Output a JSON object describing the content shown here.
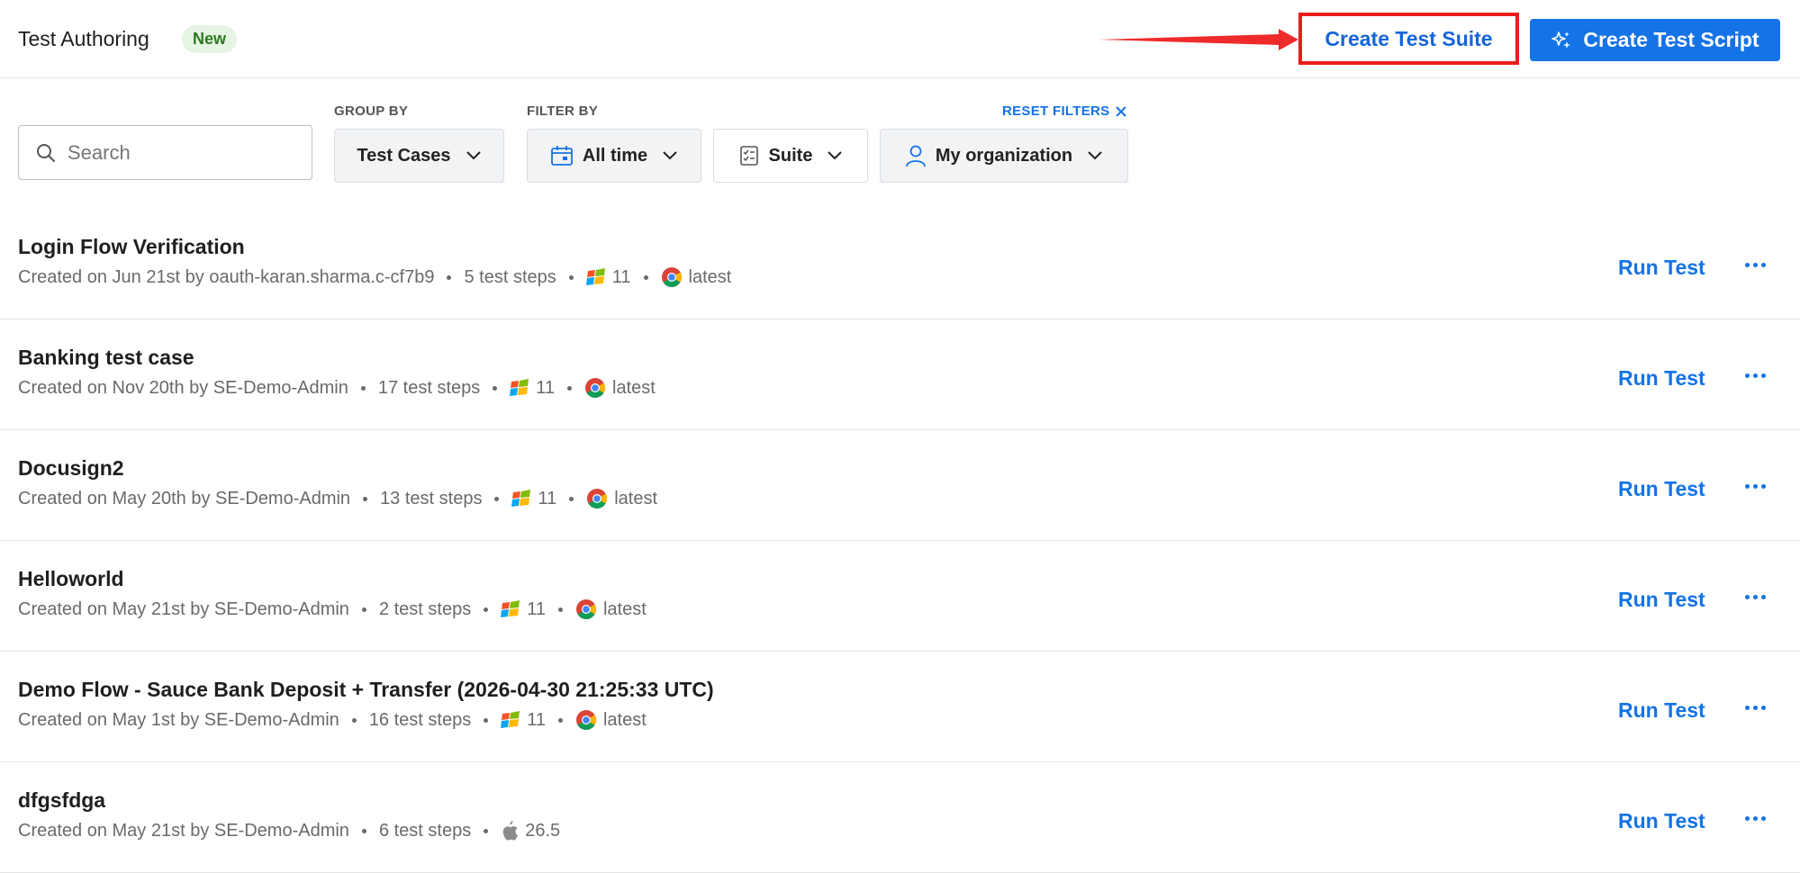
{
  "header": {
    "title": "Test Authoring",
    "badge": "New",
    "create_suite_label": "Create Test Suite",
    "create_script_label": "Create Test Script"
  },
  "filters": {
    "search_placeholder": "Search",
    "group_by_label": "GROUP BY",
    "group_by_value": "Test Cases",
    "filter_by_label": "FILTER BY",
    "time_value": "All time",
    "suite_value": "Suite",
    "org_value": "My organization",
    "reset_label": "RESET FILTERS"
  },
  "tests": [
    {
      "title": "Login Flow Verification",
      "created": "Created on Jun 21st by oauth-karan.sharma.c-cf7b9",
      "steps": "5 test steps",
      "os_icon": "windows-icon",
      "os_version": "11",
      "browser_icon": "chrome-icon",
      "browser_version": "latest",
      "run_label": "Run Test"
    },
    {
      "title": "Banking test case",
      "created": "Created on Nov 20th by SE-Demo-Admin",
      "steps": "17 test steps",
      "os_icon": "windows-icon",
      "os_version": "11",
      "browser_icon": "chrome-icon",
      "browser_version": "latest",
      "run_label": "Run Test"
    },
    {
      "title": "Docusign2",
      "created": "Created on May 20th by SE-Demo-Admin",
      "steps": "13 test steps",
      "os_icon": "windows-icon",
      "os_version": "11",
      "browser_icon": "chrome-icon",
      "browser_version": "latest",
      "run_label": "Run Test"
    },
    {
      "title": "Helloworld",
      "created": "Created on May 21st by SE-Demo-Admin",
      "steps": "2 test steps",
      "os_icon": "windows-icon",
      "os_version": "11",
      "browser_icon": "chrome-icon",
      "browser_version": "latest",
      "run_label": "Run Test"
    },
    {
      "title": "Demo Flow - Sauce Bank Deposit + Transfer (2026-04-30 21:25:33 UTC)",
      "created": "Created on May 1st by SE-Demo-Admin",
      "steps": "16 test steps",
      "os_icon": "windows-icon",
      "os_version": "11",
      "browser_icon": "chrome-icon",
      "browser_version": "latest",
      "run_label": "Run Test"
    },
    {
      "title": "dfgsfdga",
      "created": "Created on May 21st by SE-Demo-Admin",
      "steps": "6 test steps",
      "os_icon": "apple-icon",
      "os_version": "26.5",
      "run_label": "Run Test"
    }
  ],
  "colors": {
    "accent": "#1473e6",
    "highlight": "#ee1c1c",
    "badge_bg": "#e6f4e3",
    "badge_text": "#2a7a1f"
  }
}
